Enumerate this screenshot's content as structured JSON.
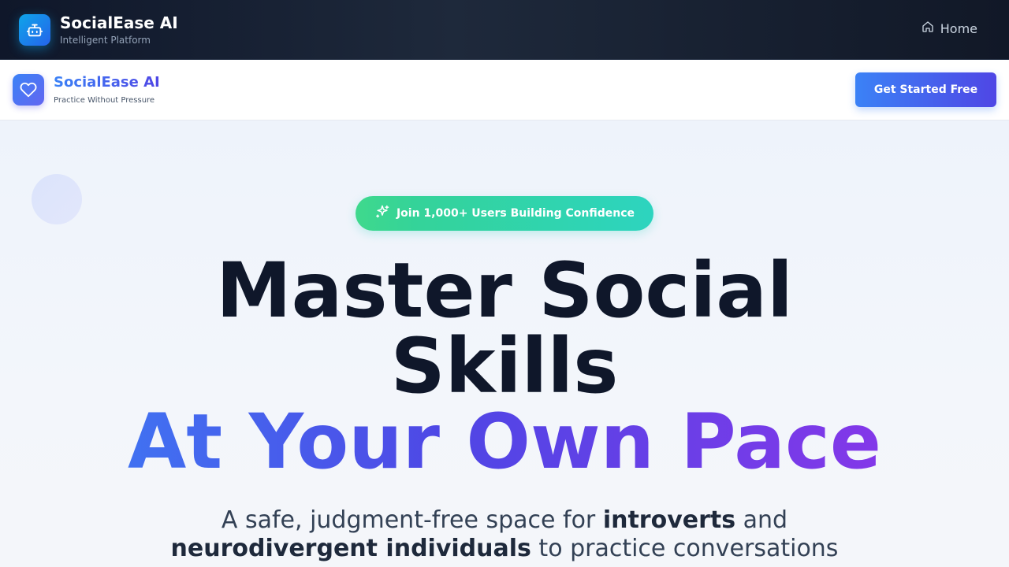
{
  "appbar": {
    "title": "SocialEase AI",
    "subtitle": "Intelligent Platform",
    "home_label": "Home",
    "logo_icon": "robot-icon",
    "home_icon": "home-icon"
  },
  "nav": {
    "brand": "SocialEase AI",
    "tagline": "Practice Without Pressure",
    "logo_icon": "heart-icon",
    "cta_label": "Get Started Free"
  },
  "hero": {
    "badge_text": "Join 1,000+ Users Building Confidence",
    "badge_icon": "sparkles-icon",
    "title_line1": "Master Social",
    "title_line2": "Skills",
    "title_accent": "At Your Own Pace",
    "desc_part1": "A safe, judgment-free space for ",
    "desc_bold1": "introverts",
    "desc_part2": " and ",
    "desc_bold2": "neurodivergent individuals",
    "desc_part3": " to practice conversations"
  },
  "colors": {
    "appbar_bg": "#0f172a",
    "brand_blue": "#3b82f6",
    "brand_indigo": "#4f46e5",
    "accent_purple": "#9333ea",
    "badge_teal": "#2dd4bf"
  }
}
